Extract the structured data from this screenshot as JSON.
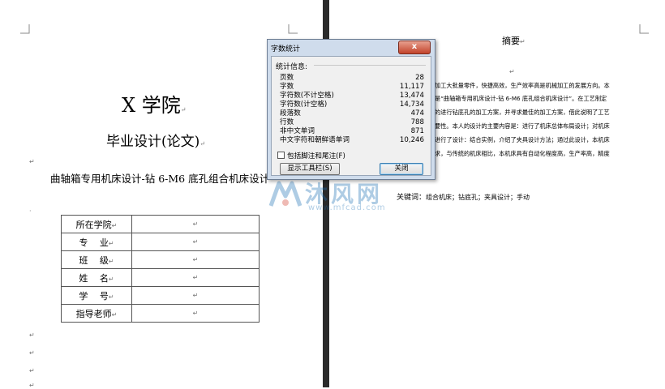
{
  "document": {
    "left_page": {
      "title": "X 学院",
      "subtitle": "毕业设计(论文)",
      "topic": "曲轴箱专用机床设计-钻 6-M6 底孔组合机床设计",
      "table_rows": [
        {
          "label": "所在学院"
        },
        {
          "label": "专　 业"
        },
        {
          "label": "班　 级"
        },
        {
          "label": "姓　 名"
        },
        {
          "label": "学　 号"
        },
        {
          "label": "指导老师"
        }
      ],
      "para_mark": "↵"
    },
    "right_page": {
      "abstract_title": "摘要",
      "abstract_lines": [
        "加工大批量零件，快捷高效，生产效率高是机械加工的发展方向。本",
        "是“曲轴箱专用机床设计-钻 6-M6 底孔组合机床设计”。在工艺制定",
        "的进行钻底孔的加工方案，并寻求最佳的加工方案，借此说明了工艺",
        "要性。本人的设计的主要内容是：进行了机床总体布局设计；对机床",
        "进行了设计：结合实例，介绍了夹具设计方法；通过此设计，本机床",
        "求，与传统的机床相比，本机床具有自动化程度高，生产率高，精度"
      ],
      "keywords_label": "关键词：",
      "keywords": "组合机床；钻底孔；夹具设计；手动"
    }
  },
  "dialog": {
    "title": "字数统计",
    "close_x": "x",
    "group_label": "统计信息:",
    "stats": [
      {
        "label": "页数",
        "value": "28"
      },
      {
        "label": "字数",
        "value": "11,117"
      },
      {
        "label": "字符数(不计空格)",
        "value": "13,474"
      },
      {
        "label": "字符数(计空格)",
        "value": "14,734"
      },
      {
        "label": "段落数",
        "value": "474"
      },
      {
        "label": "行数",
        "value": "788"
      },
      {
        "label": "非中文单词",
        "value": "871"
      },
      {
        "label": "中文字符和朝鲜语单词",
        "value": "10,246"
      }
    ],
    "include_checkbox_label": "包括脚注和尾注(F)",
    "show_toolbar_button": "显示工具栏(S)",
    "close_button": "关闭"
  },
  "watermark": {
    "text": "沐风网",
    "url": "www.mfcad.com"
  },
  "colors": {
    "divider": "#2b2b2b",
    "dialog_frame": "#cfdcec",
    "close_red": "#c2432b",
    "watermark_blue": "#1b6fb5"
  }
}
